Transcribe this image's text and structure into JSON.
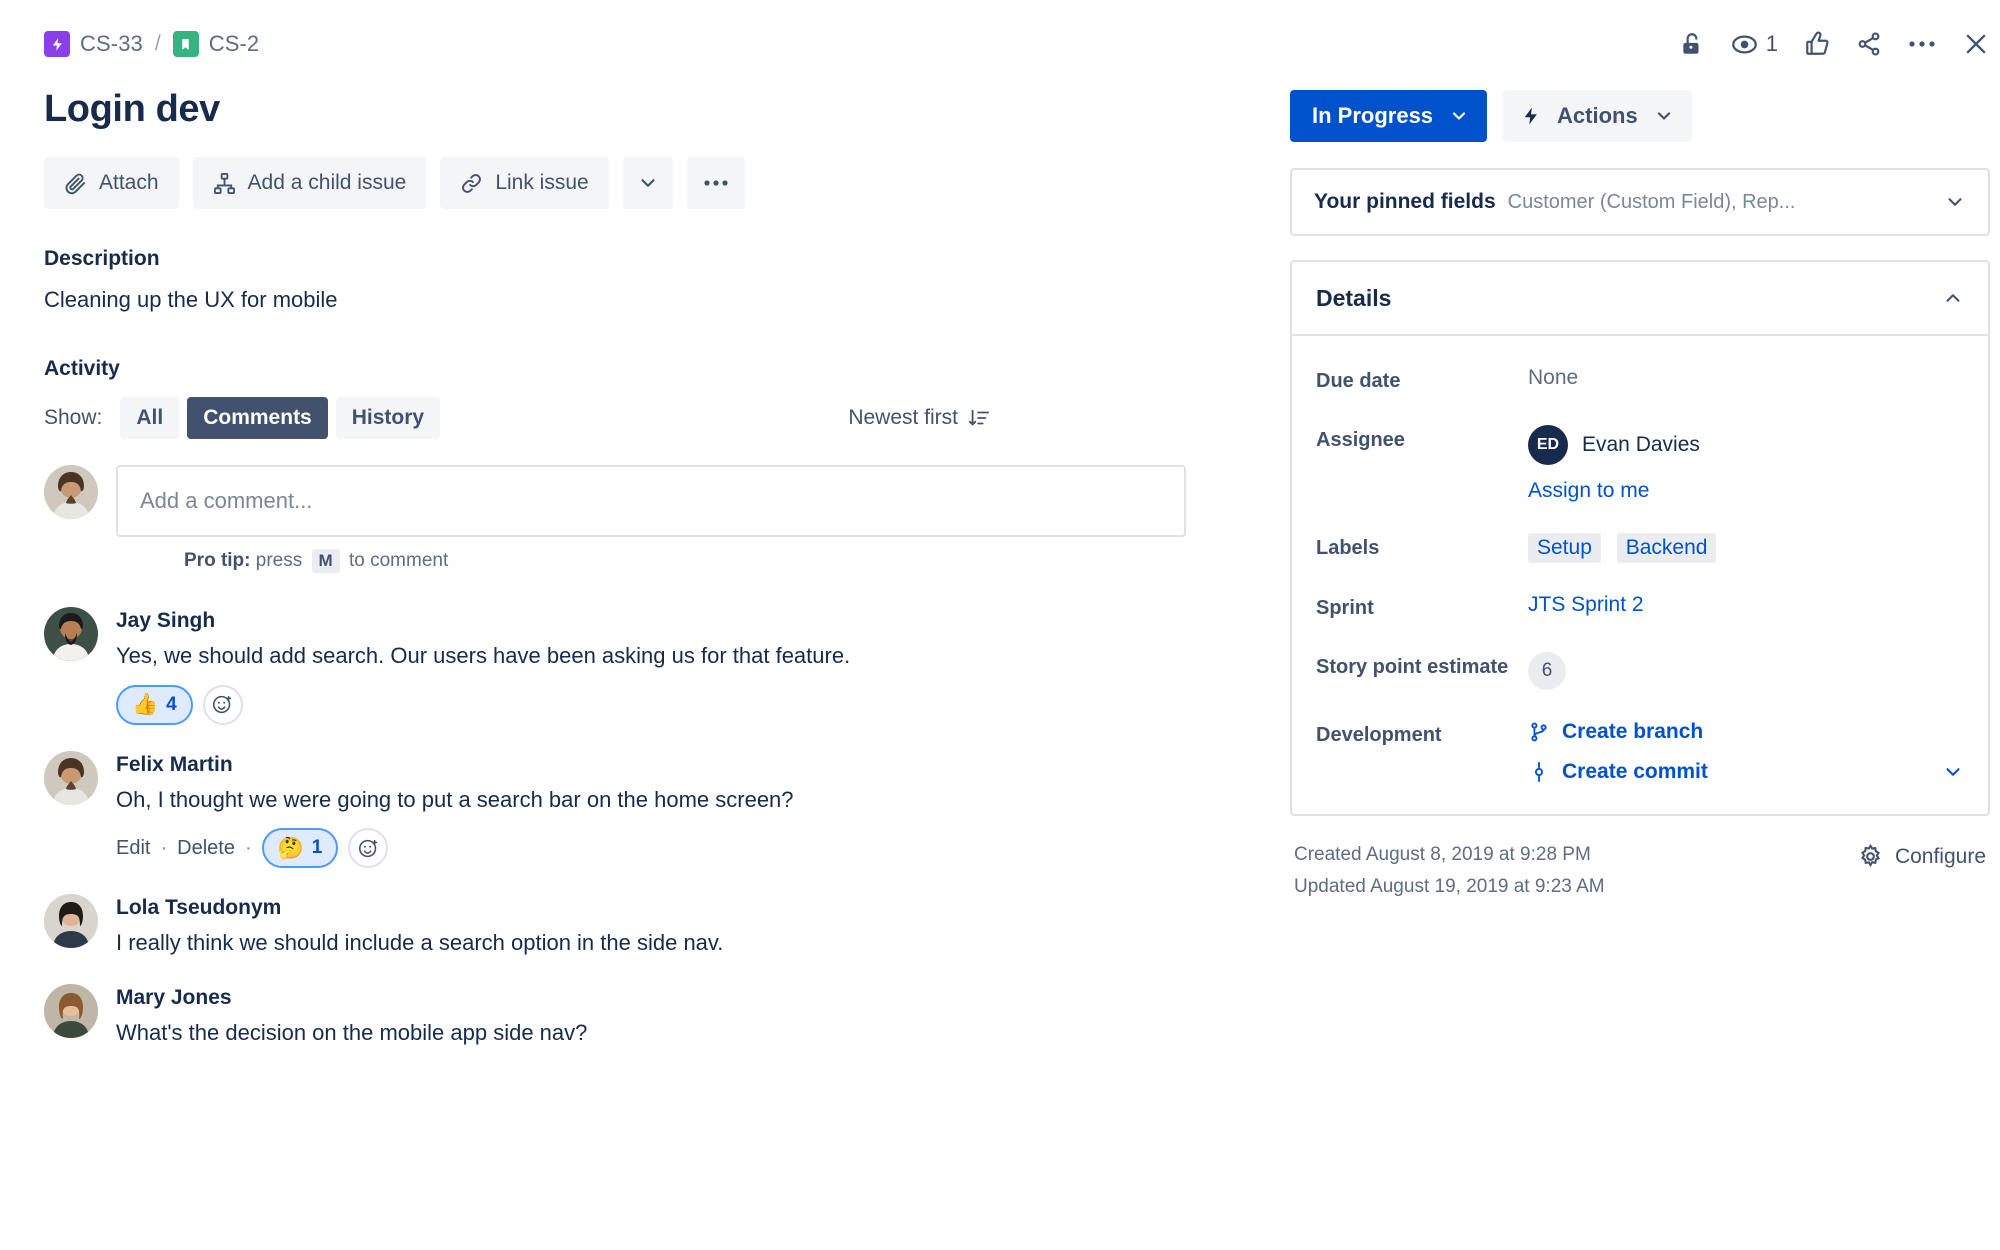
{
  "breadcrumb": {
    "parent": "CS-33",
    "separator": "/",
    "current": "CS-2",
    "parent_icon": "epic-icon",
    "current_icon": "story-icon"
  },
  "header": {
    "title": "Login dev",
    "top_icons": [
      {
        "name": "unlock-icon",
        "label": "Unlock"
      },
      {
        "name": "watch-icon",
        "label": "Watch"
      },
      {
        "name": "like-icon",
        "label": "Like"
      },
      {
        "name": "share-icon",
        "label": "Share"
      },
      {
        "name": "more-icon",
        "label": "More"
      },
      {
        "name": "close-icon",
        "label": "Close"
      }
    ],
    "watch_count": "1"
  },
  "toolbar": {
    "attach_label": "Attach",
    "add_child_label": "Add a child issue",
    "link_issue_label": "Link issue",
    "more_label": "..."
  },
  "description": {
    "heading": "Description",
    "body": "Cleaning up the UX for mobile"
  },
  "activity": {
    "heading": "Activity",
    "show_label": "Show:",
    "filters": [
      {
        "label": "All",
        "active": false
      },
      {
        "label": "Comments",
        "active": true
      },
      {
        "label": "History",
        "active": false
      }
    ],
    "sort_label": "Newest first"
  },
  "composer": {
    "placeholder": "Add a comment...",
    "protip_prefix": "Pro tip:",
    "protip_press": "press",
    "protip_key": "M",
    "protip_suffix": "to comment"
  },
  "comments": [
    {
      "author": "Jay Singh",
      "text": "Yes, we should add search. Our users have been asking us for that feature.",
      "reaction_emoji": "👍",
      "reaction_count": "4",
      "has_edit_delete": false
    },
    {
      "author": "Felix Martin",
      "text": "Oh, I thought we were going to put a search bar on the home screen?",
      "reaction_emoji": "🤔",
      "reaction_count": "1",
      "has_edit_delete": true,
      "edit_label": "Edit",
      "delete_label": "Delete",
      "dot": "·"
    },
    {
      "author": "Lola Tseudonym",
      "text": "I really think we should include a search option in the side nav.",
      "has_edit_delete": false
    },
    {
      "author": "Mary Jones",
      "text": "What's the decision on the mobile app side nav?",
      "has_edit_delete": false
    }
  ],
  "sidebar": {
    "status_label": "In Progress",
    "actions_label": "Actions",
    "pinned": {
      "title": "Your pinned fields",
      "subtitle": "Customer (Custom Field), Rep..."
    },
    "details": {
      "heading": "Details",
      "fields": {
        "due_date_label": "Due date",
        "due_date_value": "None",
        "assignee_label": "Assignee",
        "assignee_name": "Evan Davies",
        "assignee_initials": "ED",
        "assign_to_me": "Assign to me",
        "labels_label": "Labels",
        "labels": [
          "Setup",
          "Backend"
        ],
        "sprint_label": "Sprint",
        "sprint_value": "JTS Sprint 2",
        "story_points_label": "Story point estimate",
        "story_points_value": "6",
        "development_label": "Development",
        "create_branch": "Create branch",
        "create_commit": "Create commit"
      }
    },
    "footer": {
      "created": "Created August 8, 2019 at 9:28 PM",
      "updated": "Updated August 19, 2019 at 9:23 AM",
      "configure": "Configure"
    }
  },
  "colors": {
    "primary_blue": "#0052CC",
    "link_blue": "#0052CC",
    "epic_purple": "#8B3FE8",
    "story_green": "#36B37E",
    "text_dark": "#172B4D",
    "text_muted": "#5E6C84",
    "chip_bg": "#EBECF0",
    "reaction_bg": "#DEEBFF",
    "reaction_border": "#4C9AFF"
  }
}
